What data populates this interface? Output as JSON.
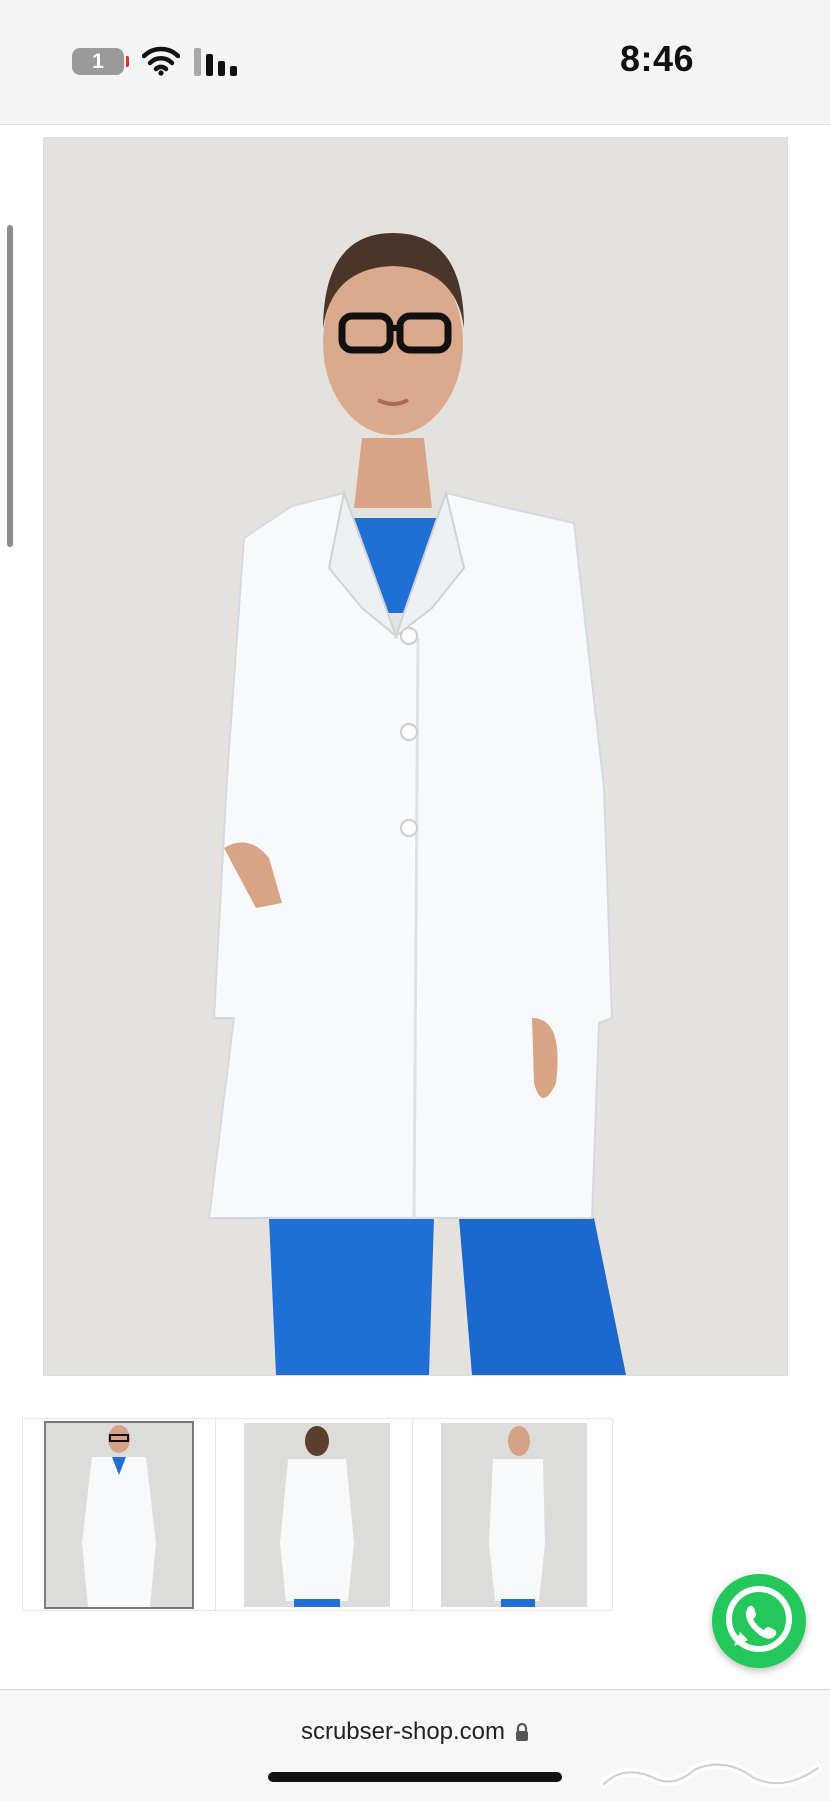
{
  "status_bar": {
    "battery_level": "1",
    "time": "8:46",
    "icons": [
      "battery-icon",
      "wifi-icon",
      "signal-icon"
    ]
  },
  "product": {
    "main_image": "lab-coat-front-model",
    "thumbnails": [
      {
        "name": "front-view",
        "selected": true
      },
      {
        "name": "back-view",
        "selected": false
      },
      {
        "name": "side-view",
        "selected": false
      }
    ]
  },
  "browser": {
    "url": "scrubser-shop.com",
    "secure_icon": "lock-icon"
  },
  "floating": {
    "chat_icon": "whatsapp-icon",
    "accent_color": "#24c75a"
  },
  "watermark": {
    "text": "حراج"
  },
  "colors": {
    "scrubs_blue": "#1f6fd4",
    "coat_white": "#f8f9fb",
    "background": "#e3e2df"
  }
}
